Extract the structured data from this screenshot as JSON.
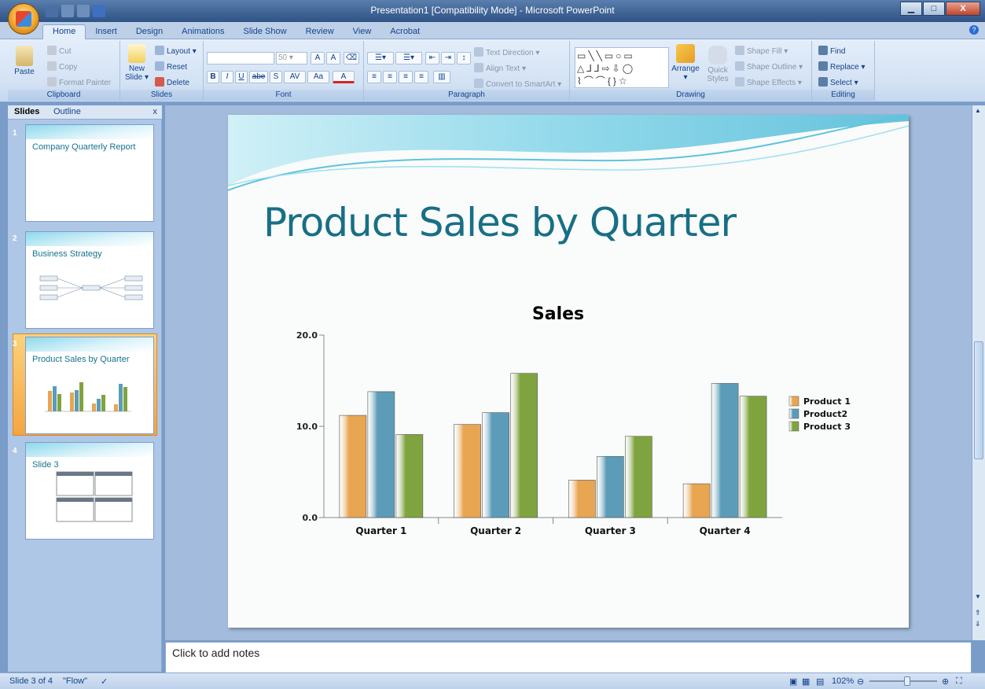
{
  "window": {
    "title": "Presentation1 [Compatibility Mode] - Microsoft PowerPoint"
  },
  "ribbon_tabs": [
    "Home",
    "Insert",
    "Design",
    "Animations",
    "Slide Show",
    "Review",
    "View",
    "Acrobat"
  ],
  "clipboard": {
    "paste": "Paste",
    "cut": "Cut",
    "copy": "Copy",
    "format_painter": "Format Painter",
    "group": "Clipboard"
  },
  "slides_group": {
    "new_slide_line1": "New",
    "new_slide_line2": "Slide",
    "layout": "Layout",
    "reset": "Reset",
    "delete": "Delete",
    "group": "Slides"
  },
  "font": {
    "size": "50",
    "group": "Font",
    "bold": "B",
    "italic": "I",
    "underline": "U",
    "strike": "abe",
    "shadow": "S",
    "spacing": "AV",
    "case": "Aa",
    "color": "A"
  },
  "paragraph": {
    "text_direction": "Text Direction",
    "align_text": "Align Text",
    "convert_smartart": "Convert to SmartArt",
    "group": "Paragraph"
  },
  "drawing": {
    "arrange": "Arrange",
    "quick_styles_1": "Quick",
    "quick_styles_2": "Styles",
    "shape_fill": "Shape Fill",
    "shape_outline": "Shape Outline",
    "shape_effects": "Shape Effects",
    "group": "Drawing"
  },
  "editing": {
    "find": "Find",
    "replace": "Replace",
    "select": "Select",
    "group": "Editing"
  },
  "panel": {
    "tab_slides": "Slides",
    "tab_outline": "Outline",
    "close": "x"
  },
  "thumbnails": [
    {
      "num": "1",
      "title": "Company Quarterly Report"
    },
    {
      "num": "2",
      "title": "Business Strategy"
    },
    {
      "num": "3",
      "title": "Product Sales by Quarter"
    },
    {
      "num": "4",
      "title": "Slide 3"
    }
  ],
  "slide": {
    "title": "Product Sales by Quarter"
  },
  "chart_data": {
    "type": "bar",
    "title": "Sales",
    "categories": [
      "Quarter 1",
      "Quarter 2",
      "Quarter 3",
      "Quarter 4"
    ],
    "series": [
      {
        "name": "Product 1",
        "values": [
          11.2,
          10.2,
          4.1,
          3.7
        ],
        "color": "#e8a552"
      },
      {
        "name": "Product2",
        "values": [
          13.8,
          11.5,
          6.7,
          14.7
        ],
        "color": "#5c9cb8"
      },
      {
        "name": "Product 3",
        "values": [
          9.1,
          15.8,
          8.9,
          13.3
        ],
        "color": "#7fa43f"
      }
    ],
    "yticks": [
      "0.0",
      "10.0",
      "20.0"
    ],
    "ylim": [
      0,
      20
    ],
    "legend": "right"
  },
  "notes": {
    "placeholder": "Click to add notes"
  },
  "status": {
    "slide_info": "Slide 3 of 4",
    "theme": "\"Flow\"",
    "zoom": "102%"
  }
}
